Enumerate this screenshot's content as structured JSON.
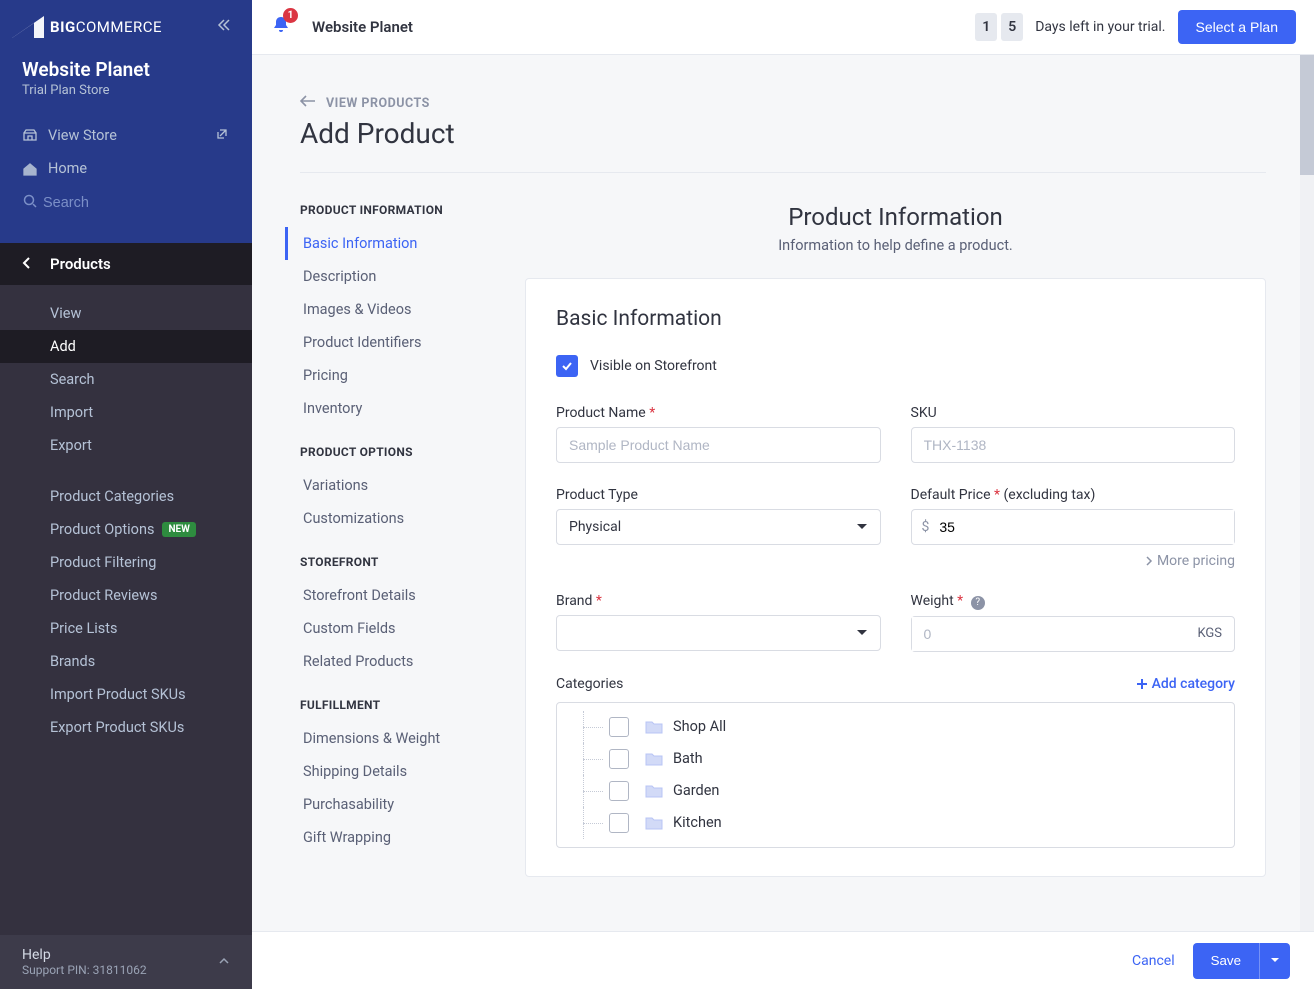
{
  "brand": {
    "logo_text_1": "BIG",
    "logo_text_2": "COMMERCE"
  },
  "store": {
    "name": "Website Planet",
    "plan": "Trial Plan Store"
  },
  "top_links": {
    "view_store": "View Store",
    "home": "Home",
    "search_placeholder": "Search"
  },
  "nav": {
    "section_title": "Products",
    "items": {
      "view": "View",
      "add": "Add",
      "search": "Search",
      "import": "Import",
      "export": "Export",
      "categories": "Product Categories",
      "options": "Product Options",
      "options_badge": "NEW",
      "filtering": "Product Filtering",
      "reviews": "Product Reviews",
      "price_lists": "Price Lists",
      "brands": "Brands",
      "import_skus": "Import Product SKUs",
      "export_skus": "Export Product SKUs"
    }
  },
  "sidebar_footer": {
    "help": "Help",
    "pin_label": "Support PIN: ",
    "pin": "31811062"
  },
  "header": {
    "title": "Website Planet",
    "notification_count": "1",
    "trial": {
      "digit1": "1",
      "digit2": "5",
      "text": "Days left in your trial."
    },
    "select_plan": "Select a Plan"
  },
  "breadcrumb": {
    "back": "VIEW PRODUCTS"
  },
  "page": {
    "title": "Add Product"
  },
  "secnav": {
    "group1": {
      "title": "PRODUCT INFORMATION",
      "items": {
        "basic": "Basic Information",
        "desc": "Description",
        "images": "Images & Videos",
        "identifiers": "Product Identifiers",
        "pricing": "Pricing",
        "inventory": "Inventory"
      }
    },
    "group2": {
      "title": "PRODUCT OPTIONS",
      "items": {
        "variations": "Variations",
        "customizations": "Customizations"
      }
    },
    "group3": {
      "title": "STOREFRONT",
      "items": {
        "details": "Storefront Details",
        "custom": "Custom Fields",
        "related": "Related Products"
      }
    },
    "group4": {
      "title": "FULFILLMENT",
      "items": {
        "dimensions": "Dimensions & Weight",
        "shipping": "Shipping Details",
        "purchasability": "Purchasability",
        "gift": "Gift Wrapping"
      }
    }
  },
  "section": {
    "title": "Product Information",
    "subtitle": "Information to help define a product."
  },
  "form": {
    "card_title": "Basic Information",
    "visible_label": "Visible on Storefront",
    "product_name": {
      "label": "Product Name ",
      "placeholder": "Sample Product Name"
    },
    "sku": {
      "label": "SKU",
      "placeholder": "THX-1138"
    },
    "product_type": {
      "label": "Product Type",
      "value": "Physical"
    },
    "default_price": {
      "label": "Default Price ",
      "suffix": "(excluding tax)",
      "prefix": "$",
      "value": "35"
    },
    "more_pricing": "More pricing",
    "brand": {
      "label": "Brand ",
      "value": ""
    },
    "weight": {
      "label": "Weight ",
      "placeholder": "0",
      "unit": "KGS"
    },
    "categories": {
      "label": "Categories",
      "add": "Add category",
      "items": {
        "shop_all": "Shop All",
        "bath": "Bath",
        "garden": "Garden",
        "kitchen": "Kitchen"
      }
    }
  },
  "footer": {
    "cancel": "Cancel",
    "save": "Save"
  }
}
